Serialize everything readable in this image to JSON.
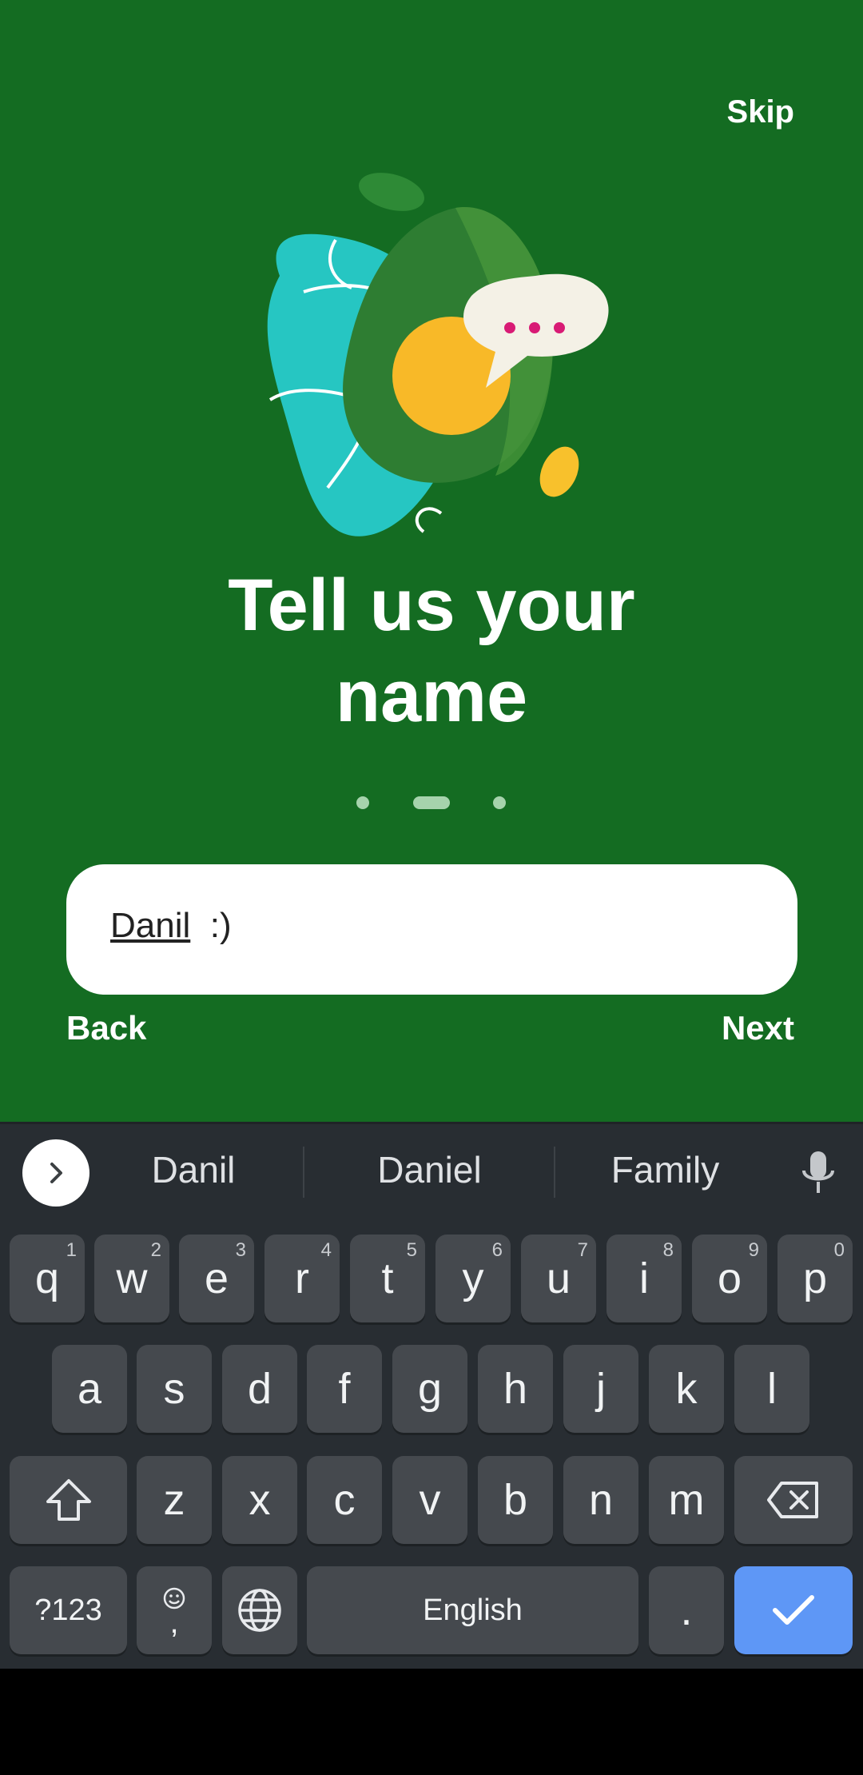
{
  "app": {
    "skip_label": "Skip",
    "title_line1": "Tell us your",
    "title_line2": "name",
    "name_value": "Danil",
    "name_suffix": "  :)",
    "back_label": "Back",
    "next_label": "Next",
    "page_indicator": {
      "pages": 3,
      "current": 2
    },
    "colors": {
      "background": "#146c22",
      "bubble_dots": "#d81b75"
    }
  },
  "keyboard": {
    "suggestions": [
      "Danil",
      "Daniel",
      "Family"
    ],
    "row1": [
      {
        "key": "q",
        "hint": "1"
      },
      {
        "key": "w",
        "hint": "2"
      },
      {
        "key": "e",
        "hint": "3"
      },
      {
        "key": "r",
        "hint": "4"
      },
      {
        "key": "t",
        "hint": "5"
      },
      {
        "key": "y",
        "hint": "6"
      },
      {
        "key": "u",
        "hint": "7"
      },
      {
        "key": "i",
        "hint": "8"
      },
      {
        "key": "o",
        "hint": "9"
      },
      {
        "key": "p",
        "hint": "0"
      }
    ],
    "row2": [
      "a",
      "s",
      "d",
      "f",
      "g",
      "h",
      "j",
      "k",
      "l"
    ],
    "row3": [
      "z",
      "x",
      "c",
      "v",
      "b",
      "n",
      "m"
    ],
    "symbols_label": "?123",
    "comma_label": ",",
    "space_label": "English",
    "period_label": ".",
    "icons": [
      "chevron-right-icon",
      "microphone-icon",
      "shift-icon",
      "backspace-icon",
      "emoji-icon",
      "globe-icon",
      "checkmark-icon"
    ]
  }
}
